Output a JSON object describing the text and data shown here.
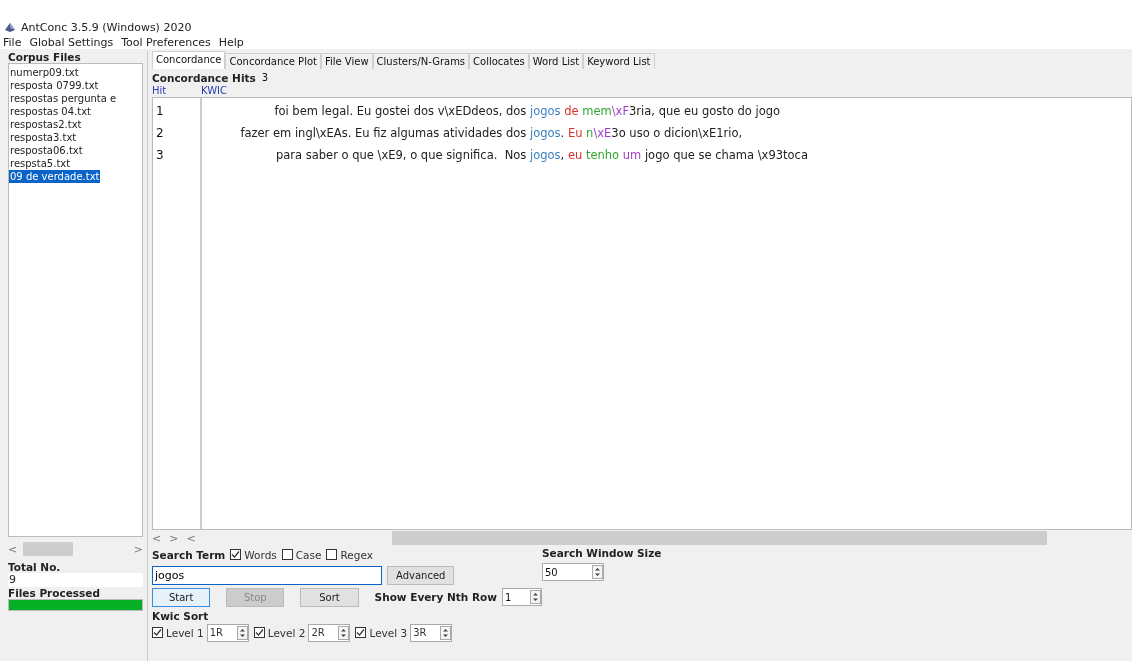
{
  "window": {
    "title": "AntConc 3.5.9 (Windows) 2020"
  },
  "menu": [
    "File",
    "Global Settings",
    "Tool Preferences",
    "Help"
  ],
  "sidebar": {
    "title": "Corpus Files",
    "files": [
      {
        "name": "numerp09.txt",
        "selected": false
      },
      {
        "name": "resposta 0799.txt",
        "selected": false
      },
      {
        "name": "respostas  pergunta e",
        "selected": false
      },
      {
        "name": "respostas 04.txt",
        "selected": false
      },
      {
        "name": "respostas2.txt",
        "selected": false
      },
      {
        "name": "resposta3.txt",
        "selected": false
      },
      {
        "name": "resposta06.txt",
        "selected": false
      },
      {
        "name": "respsta5.txt",
        "selected": false
      },
      {
        "name": "09 de verdade.txt",
        "selected": true
      }
    ],
    "scroll_left": "<",
    "scroll_right": ">",
    "total_label": "Total No.",
    "total_value": "9",
    "processed_label": "Files Processed",
    "progress": {
      "level": 1
    }
  },
  "tabs": [
    {
      "label": "Concordance",
      "selected": true
    },
    {
      "label": "Concordance Plot",
      "selected": false
    },
    {
      "label": "File View",
      "selected": false
    },
    {
      "label": "Clusters/N-Grams",
      "selected": false
    },
    {
      "label": "Collocates",
      "selected": false
    },
    {
      "label": "Word List",
      "selected": false
    },
    {
      "label": "Keyword List",
      "selected": false
    }
  ],
  "hits": {
    "label": "Concordance Hits",
    "value": "3"
  },
  "table": {
    "columns": [
      "Hit",
      "KWIC"
    ],
    "rows": [
      {
        "hit": "1",
        "left": "foi bem legal. Eu gostei dos v\\xEDdeos, dos ",
        "segments": [
          {
            "text": "jogos",
            "color": "#3b7fc4"
          },
          {
            "text": " de",
            "color": "#d9302a"
          },
          {
            "text": " mem",
            "color": "#2fa52f"
          },
          {
            "text": "\\xF",
            "color": "#a13fc4"
          },
          {
            "text": "3ria, que eu gosto do jogo",
            "color": "#222222"
          }
        ]
      },
      {
        "hit": "2",
        "left": "fazer em ingl\\xEAs. Eu fiz algumas atividades dos ",
        "segments": [
          {
            "text": "jogos",
            "color": "#3b7fc4"
          },
          {
            "text": ". "
          },
          {
            "text": "Eu",
            "color": "#d9302a"
          },
          {
            "text": " n",
            "color": "#2fa52f"
          },
          {
            "text": "\\xE",
            "color": "#a13fc4"
          },
          {
            "text": "3o uso o dicion\\xE1rio,",
            "color": "#222222"
          }
        ]
      },
      {
        "hit": "3",
        "left": "para saber o que \\xE9, o que significa.  Nos ",
        "segments": [
          {
            "text": "jogos",
            "color": "#3b7fc4"
          },
          {
            "text": ", "
          },
          {
            "text": "eu",
            "color": "#d9302a"
          },
          {
            "text": " tenho",
            "color": "#2fa52f"
          },
          {
            "text": " um",
            "color": "#a13fc4"
          },
          {
            "text": " jogo que se chama \\x93toca",
            "color": "#222222"
          }
        ]
      }
    ]
  },
  "hscroll": {
    "left": "<",
    "right": ">",
    "back": "<"
  },
  "search": {
    "label": "Search Term",
    "options": [
      {
        "label": "Words",
        "checked": true
      },
      {
        "label": "Case",
        "checked": false
      },
      {
        "label": "Regex",
        "checked": false
      }
    ],
    "value": "jogos",
    "advanced": "Advanced"
  },
  "buttons": [
    {
      "label": "Start",
      "disabled": false,
      "focused": true
    },
    {
      "label": "Stop",
      "disabled": true,
      "focused": false
    },
    {
      "label": "Sort",
      "disabled": false,
      "focused": false
    }
  ],
  "nth_row": {
    "label": "Show Every Nth Row",
    "value": "1"
  },
  "window_size": {
    "label": "Search Window Size",
    "value": "50"
  },
  "kwic_sort": {
    "label": "Kwic Sort",
    "levels": [
      {
        "label": "Level 1",
        "checked": true,
        "value": "1R"
      },
      {
        "label": "Level 2",
        "checked": true,
        "value": "2R"
      },
      {
        "label": "Level 3",
        "checked": true,
        "value": "3R"
      }
    ]
  }
}
